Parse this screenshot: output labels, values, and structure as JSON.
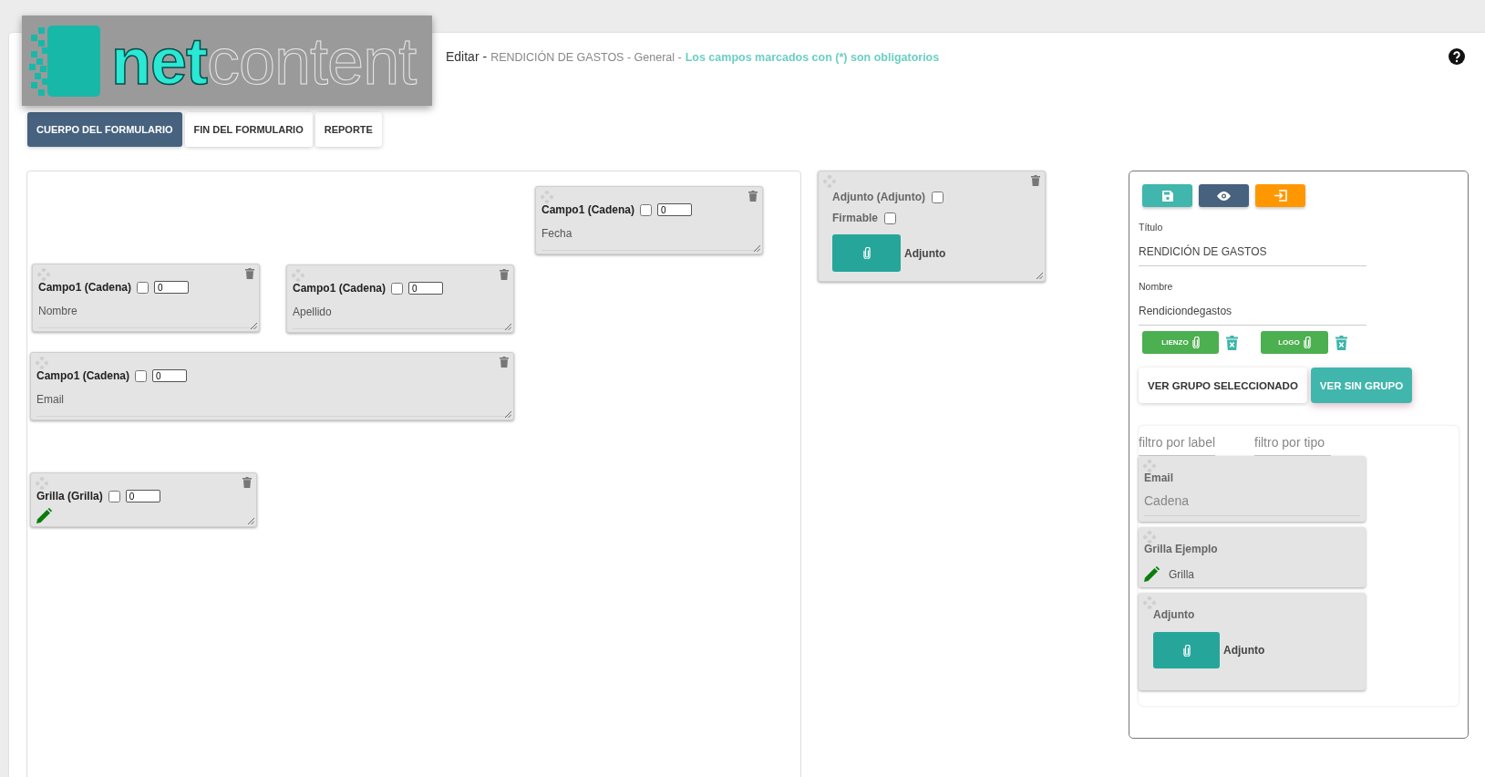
{
  "logo": {
    "text_bold": "net",
    "text_light": "content"
  },
  "header": [
    {
      "kind": "action",
      "text": "Editar -"
    },
    {
      "kind": "meta",
      "text": "RENDICIÓN DE GASTOS - General -"
    },
    {
      "kind": "note",
      "text": "Los campos marcados con (*) son obligatorios"
    }
  ],
  "tabs": [
    {
      "label": "CUERPO DEL FORMULARIO",
      "selected": true
    },
    {
      "label": "FIN DEL FORMULARIO",
      "selected": false
    },
    {
      "label": "REPORTE",
      "selected": false
    }
  ],
  "canvas_fields": [
    {
      "kind": "text",
      "title": "Campo1 (Cadena)",
      "checked": false,
      "order": "0",
      "label": "Fecha"
    },
    {
      "kind": "text",
      "title": "Campo1 (Cadena)",
      "checked": false,
      "order": "0",
      "label": "Nombre"
    },
    {
      "kind": "text",
      "title": "Campo1 (Cadena)",
      "checked": false,
      "order": "0",
      "label": "Apellido"
    },
    {
      "kind": "text",
      "title": "Campo1 (Cadena)",
      "checked": false,
      "order": "0",
      "label": "Email"
    },
    {
      "kind": "grid",
      "title": "Grilla (Grilla)",
      "checked": false,
      "order": "0"
    }
  ],
  "attachment_field": {
    "title": "Adjunto (Adjunto)",
    "checked": false,
    "signable_label": "Firmable",
    "signable": false,
    "button_label": "Adjunto"
  },
  "side_panel": {
    "fields": [
      {
        "label": "Título",
        "value": "RENDICIÓN DE GASTOS"
      },
      {
        "label": "Nombre",
        "value": "Rendiciondegastos"
      }
    ],
    "uploads": [
      {
        "label": "LIENZO"
      },
      {
        "label": "LOGO"
      }
    ],
    "group_toggle": [
      {
        "label": "VER GRUPO SELECCIONADO",
        "selected": false
      },
      {
        "label": "VER SIN GRUPO",
        "selected": true
      }
    ],
    "filters": [
      {
        "placeholder": "filtro por label"
      },
      {
        "placeholder": "filtro por tipo"
      }
    ],
    "items": [
      {
        "kind": "text",
        "title": "Email",
        "type": "Cadena"
      },
      {
        "kind": "grid",
        "title": "Grilla Ejemplo",
        "type": "Grilla"
      },
      {
        "kind": "attachment",
        "title": "Adjunto",
        "type": "Adjunto"
      }
    ]
  }
}
